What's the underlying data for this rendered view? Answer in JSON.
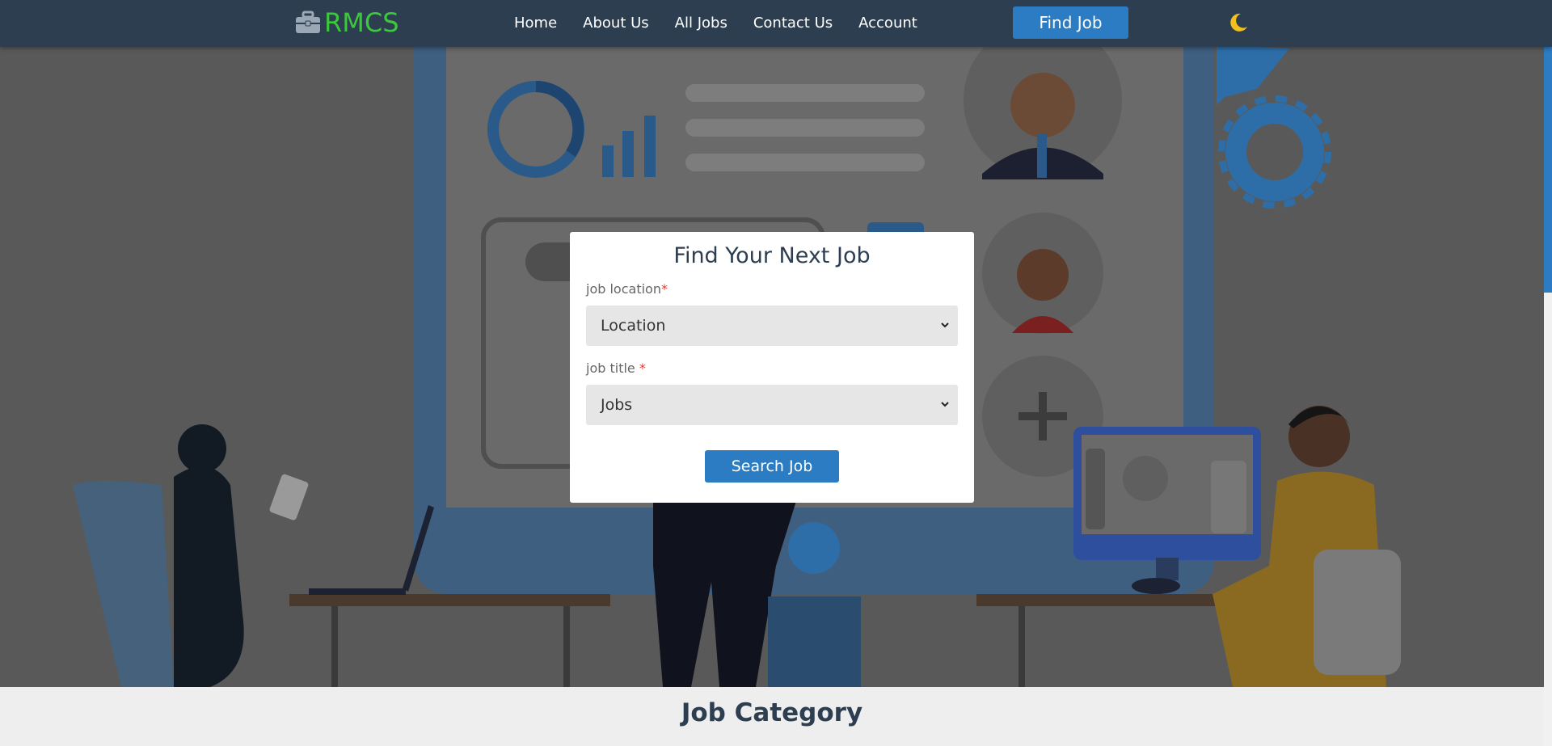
{
  "brand": {
    "name": "RMCS",
    "icon": "briefcase-icon",
    "color": "#3cc73c"
  },
  "nav": {
    "items": [
      {
        "label": "Home"
      },
      {
        "label": "About Us"
      },
      {
        "label": "All Jobs"
      },
      {
        "label": "Contact Us"
      },
      {
        "label": "Account"
      }
    ],
    "cta_label": "Find Job",
    "theme_toggle_icon": "moon-icon"
  },
  "search_form": {
    "title": "Find Your Next Job",
    "location_label": "job location",
    "location_value": "Location",
    "title_label": "job title ",
    "title_value": "Jobs",
    "required_mark": "*",
    "submit_label": "Search Job"
  },
  "category": {
    "title": "Job Category"
  },
  "colors": {
    "navbar": "#2d3e50",
    "accent": "#2b7cc2",
    "brand": "#3cc73c",
    "required": "#e53935"
  }
}
